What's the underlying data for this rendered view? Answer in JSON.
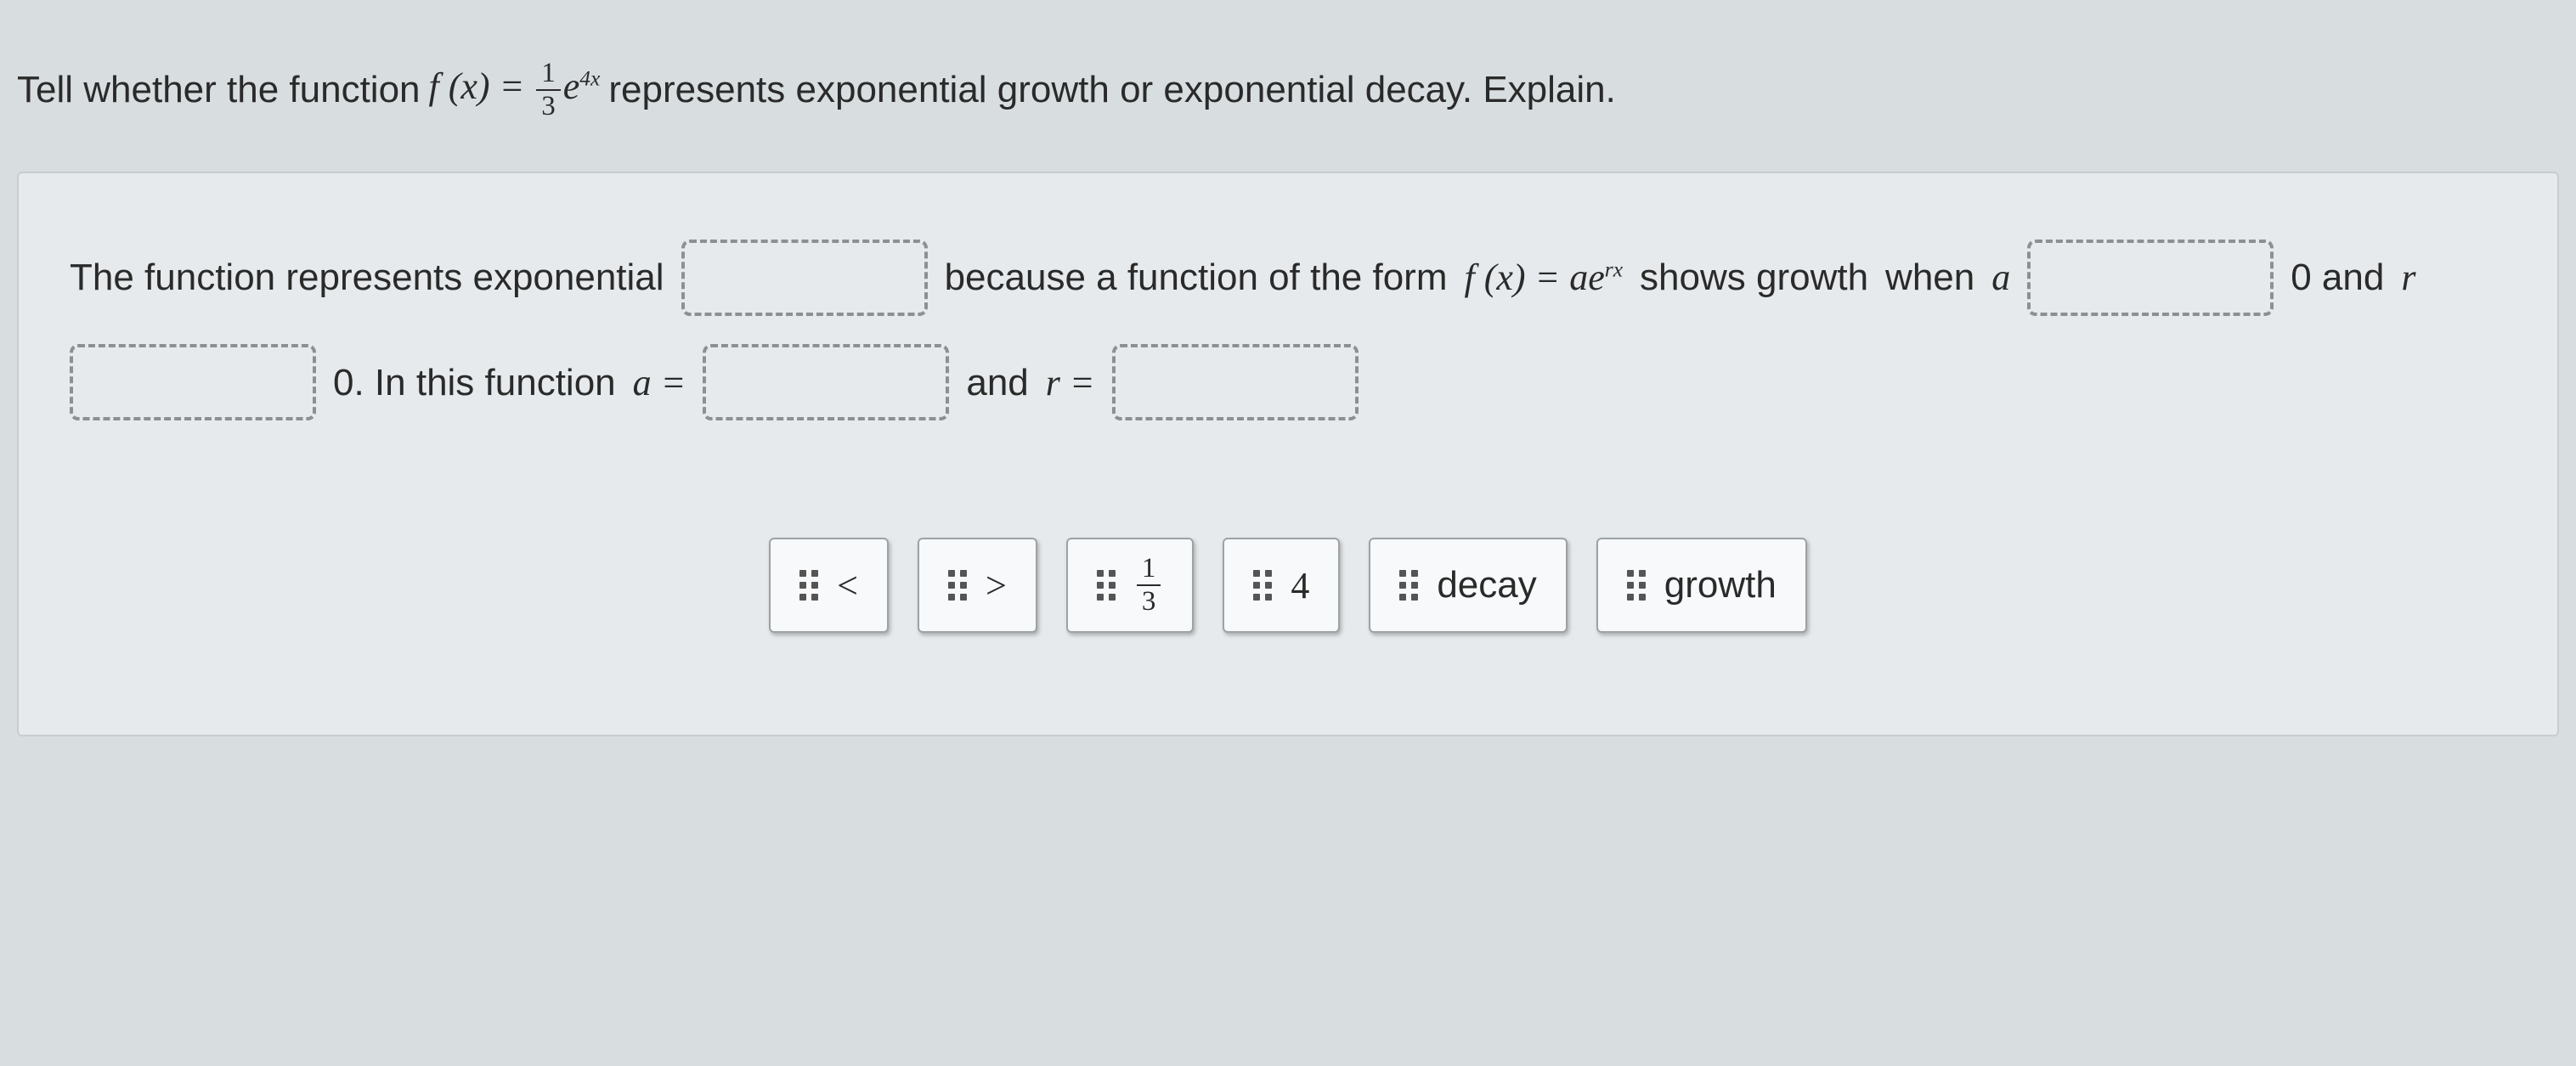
{
  "prompt": {
    "pre": "Tell whether the function",
    "func_lhs": "f (x) =",
    "frac_num": "1",
    "frac_den": "3",
    "e": "e",
    "exp": "4x",
    "post": "represents exponential growth or exponential decay. Explain."
  },
  "answer": {
    "t1": "The function represents exponential",
    "t2": "because a function of the form",
    "form_lhs": "f (x) = a",
    "form_e": "e",
    "form_exp": "rx",
    "t3": "shows growth",
    "t4": "when",
    "a": "a",
    "t5": "0 and",
    "r": "r",
    "t6": "0. In this function",
    "a_eq": "a =",
    "t7": "and",
    "r_eq": "r ="
  },
  "tiles": {
    "lt": "<",
    "gt": ">",
    "frac_num": "1",
    "frac_den": "3",
    "four": "4",
    "decay": "decay",
    "growth": "growth"
  }
}
